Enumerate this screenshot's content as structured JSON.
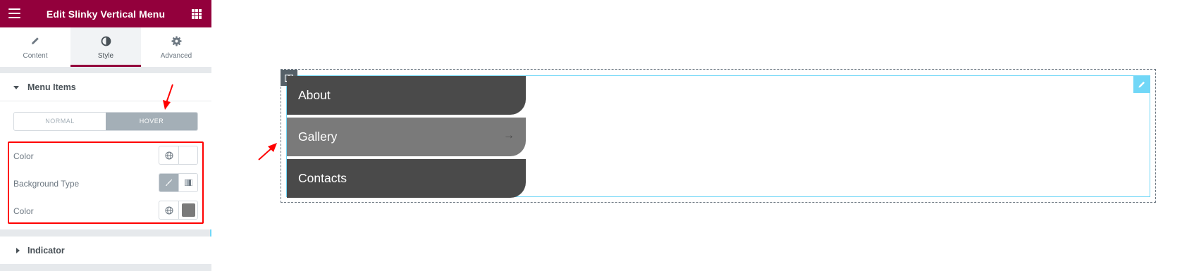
{
  "header": {
    "title": "Edit Slinky Vertical Menu"
  },
  "tabs": [
    {
      "label": "Content",
      "icon": "pencil-icon"
    },
    {
      "label": "Style",
      "icon": "half-circle-icon"
    },
    {
      "label": "Advanced",
      "icon": "gear-icon"
    }
  ],
  "active_tab": "Style",
  "menu_items_section": {
    "title": "Menu Items",
    "state_tabs": [
      "NORMAL",
      "HOVER"
    ],
    "active_state": "HOVER",
    "controls": [
      {
        "label": "Color",
        "swatch": "#ffffff"
      },
      {
        "label": "Background Type"
      },
      {
        "label": "Color",
        "swatch": "#7a7a7a"
      }
    ]
  },
  "indicator_section": {
    "title": "Indicator"
  },
  "preview": {
    "items": [
      {
        "label": "About",
        "state": "normal"
      },
      {
        "label": "Gallery",
        "state": "hover",
        "arrow": "→"
      },
      {
        "label": "Contacts",
        "state": "normal"
      }
    ]
  },
  "colors": {
    "brand": "#93003c",
    "item_bg": "#4a4a4a",
    "item_hover_bg": "#7a7a7a",
    "annotation": "#ff0000",
    "selection": "#71d7f7"
  }
}
